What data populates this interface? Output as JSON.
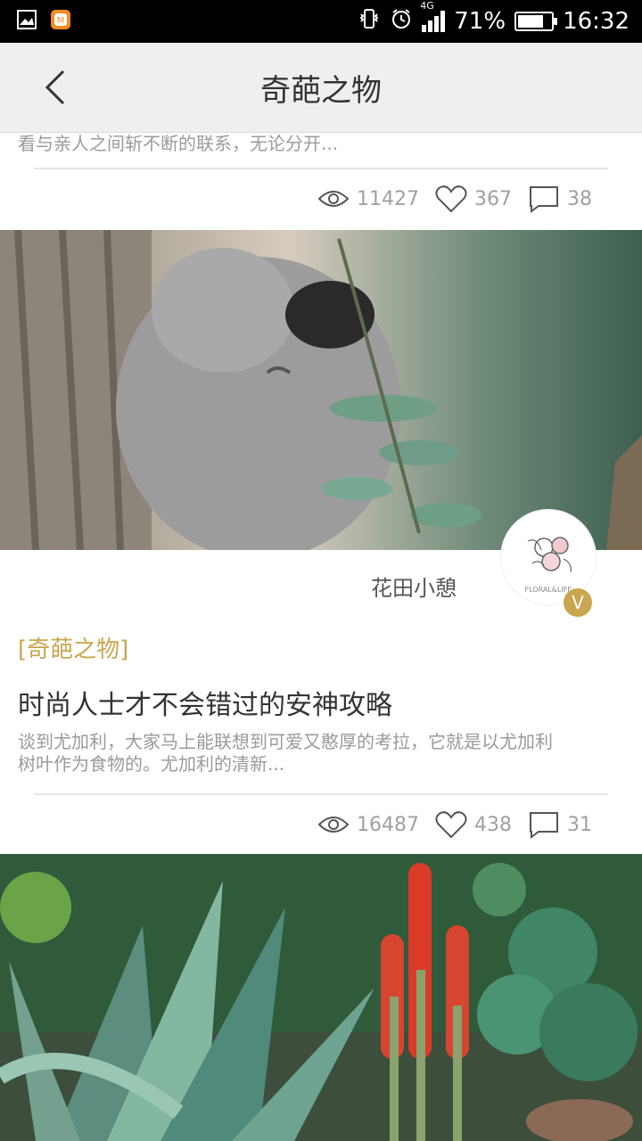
{
  "status_bar": {
    "network": "4G",
    "battery": "71%",
    "battery_level": 0.71,
    "time": "16:32",
    "left_icons": [
      "gallery-icon",
      "app-icon"
    ],
    "right_icons": [
      "vibrate-icon",
      "alarm-icon",
      "signal-icon",
      "battery-icon"
    ]
  },
  "header": {
    "title": "奇葩之物"
  },
  "items": [
    {
      "excerpt_partial": "看与亲人之间斩不断的联系，无论分开...",
      "views": "11427",
      "likes": "367",
      "comments": "38"
    },
    {
      "author": "花田小憩",
      "tag": "[奇葩之物]",
      "title": "时尚人士才不会错过的安神攻略",
      "excerpt": "谈到尤加利，大家马上能联想到可爱又憨厚的考拉，它就是以尤加利树叶作为食物的。尤加利的清新...",
      "views": "16487",
      "likes": "438",
      "comments": "31",
      "avatar_logo": "FLORAL&LIFE",
      "badge": "V"
    }
  ],
  "colors": {
    "accent": "#c9a64f",
    "nav_bg": "#efefef",
    "text_muted": "#9b9b9b"
  }
}
